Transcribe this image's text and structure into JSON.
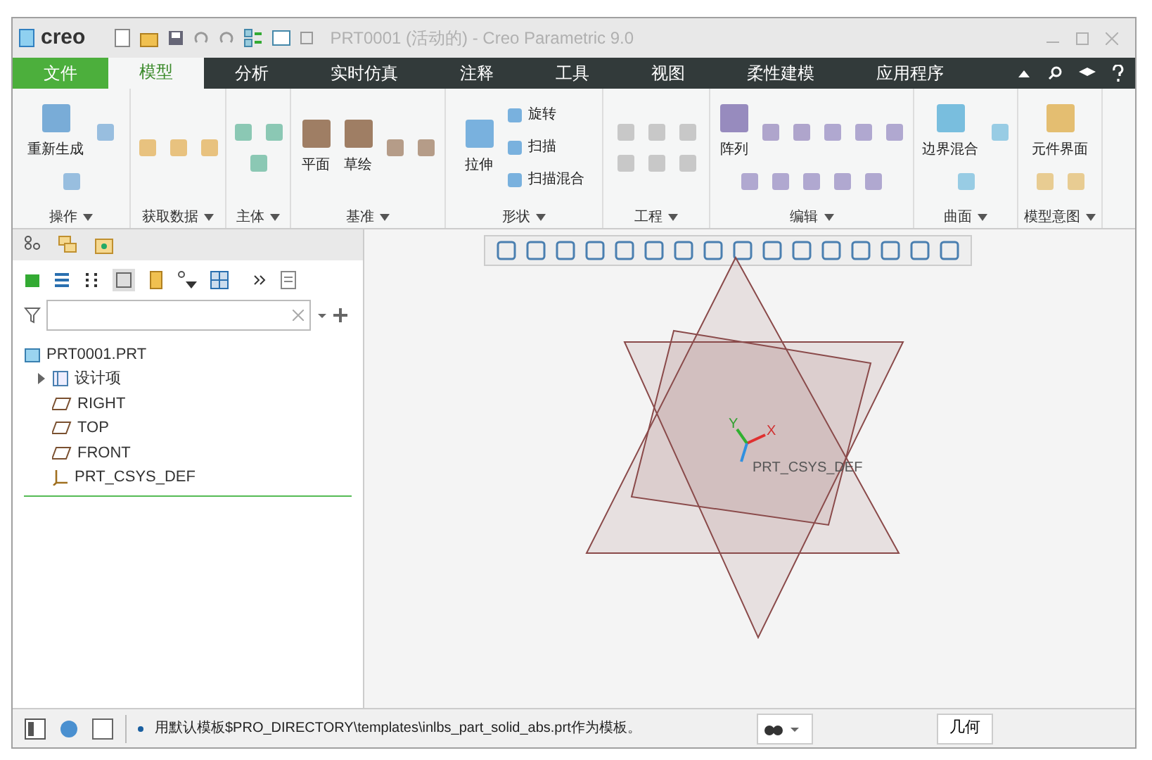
{
  "window": {
    "logo": "creo",
    "title": "PRT0001 (活动的) - Creo Parametric 9.0"
  },
  "ribbon_tabs": [
    {
      "label": "文件",
      "kind": "file",
      "selected": false
    },
    {
      "label": "模型",
      "kind": "tab",
      "selected": true
    },
    {
      "label": "分析",
      "kind": "tab",
      "selected": false
    },
    {
      "label": "实时仿真",
      "kind": "tab",
      "selected": false
    },
    {
      "label": "注释",
      "kind": "tab",
      "selected": false
    },
    {
      "label": "工具",
      "kind": "tab",
      "selected": false
    },
    {
      "label": "视图",
      "kind": "tab",
      "selected": false
    },
    {
      "label": "柔性建模",
      "kind": "tab",
      "selected": false
    },
    {
      "label": "应用程序",
      "kind": "tab",
      "selected": false
    }
  ],
  "ribbon_groups": [
    {
      "label": "操作",
      "commands": [
        "重新生成"
      ]
    },
    {
      "label": "获取数据"
    },
    {
      "label": "主体"
    },
    {
      "label": "基准",
      "commands": [
        "平面",
        "草绘"
      ]
    },
    {
      "label": "形状",
      "commands": [
        "拉伸",
        "旋转",
        "扫描",
        "扫描混合"
      ]
    },
    {
      "label": "工程"
    },
    {
      "label": "编辑",
      "commands": [
        "阵列"
      ]
    },
    {
      "label": "曲面",
      "commands": [
        "边界混合"
      ]
    },
    {
      "label": "模型意图",
      "commands": [
        "元件界面"
      ]
    }
  ],
  "model_tree": {
    "items": [
      {
        "label": "PRT0001.PRT",
        "kind": "part",
        "expanded": true,
        "children": [
          {
            "label": "设计项",
            "kind": "folder",
            "expanded": false
          },
          {
            "label": "RIGHT",
            "kind": "plane"
          },
          {
            "label": "TOP",
            "kind": "plane"
          },
          {
            "label": "FRONT",
            "kind": "plane"
          },
          {
            "label": "PRT_CSYS_DEF",
            "kind": "csys"
          }
        ]
      }
    ]
  },
  "graphics": {
    "csys_label": "PRT_CSYS_DEF",
    "axis_x": "X",
    "axis_y": "Y"
  },
  "status_bar": {
    "message": "用默认模板$PRO_DIRECTORY\\templates\\inlbs_part_solid_abs.prt作为模板。",
    "filter": "几何"
  }
}
